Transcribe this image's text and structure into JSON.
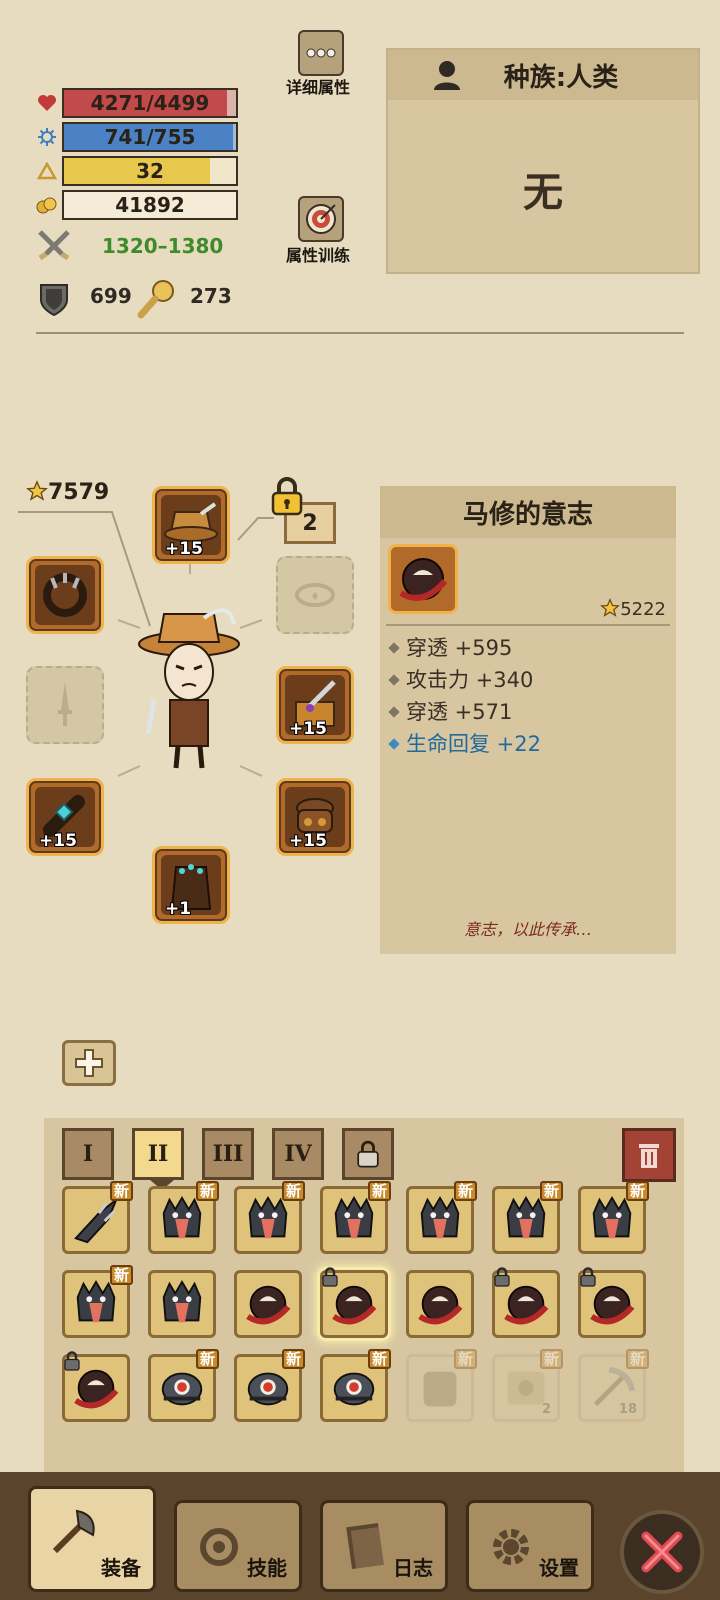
{
  "stats": {
    "hp": {
      "text": "4271/4499",
      "ratio": 0.949,
      "color": "#c24a4a"
    },
    "mp": {
      "text": "741/755",
      "ratio": 0.981,
      "color": "#4b82c6"
    },
    "level": {
      "text": "32",
      "ratio": 0.85,
      "color": "#e8c74d"
    },
    "gold": {
      "text": "41892"
    },
    "attack": "1320–1380",
    "defense": "699",
    "crit": "273"
  },
  "top_buttons": {
    "detail_label": "详细属性",
    "training_label": "属性训练"
  },
  "race": {
    "title": "种族:人类",
    "value": "无"
  },
  "equipment": {
    "power": "7579",
    "tag_number": "2",
    "hat_plus": "+15",
    "weapon_plus": "+15",
    "ring_plus": "+15",
    "gloves_plus": "+15",
    "armor_plus": "+1"
  },
  "detail": {
    "title": "马修的意志",
    "score": "5222",
    "attributes": [
      {
        "text": "穿透 +595"
      },
      {
        "text": "攻击力 +340"
      },
      {
        "text": "穿透 +571"
      },
      {
        "text": "生命回复 +22"
      }
    ],
    "flavor": "意志，以此传承…"
  },
  "inventory": {
    "tabs": [
      "I",
      "II",
      "III",
      "IV"
    ],
    "active_tab": 1,
    "new_label": "新",
    "counts": [
      "2",
      "18"
    ]
  },
  "nav": {
    "equip": "装备",
    "skills": "技能",
    "log": "日志",
    "settings": "设置"
  },
  "colors": {
    "parchment": "#e7dcc0",
    "panel": "#d7c6a0",
    "slot_border": "#f0b24a",
    "accent_blue": "#226a9c"
  }
}
